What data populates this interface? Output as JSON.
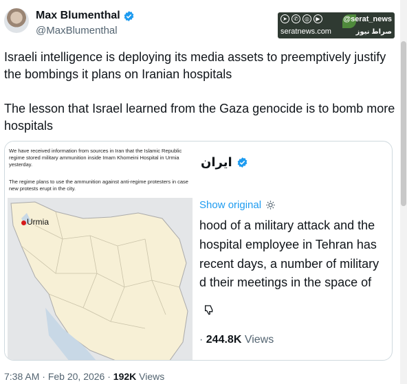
{
  "author": {
    "display_name": "Max Blumenthal",
    "handle": "@MaxBlumenthal",
    "verified_color": "#1d9bf0"
  },
  "watermark": {
    "handle": "@serat_news",
    "site": "seratnews.com",
    "arabic_name": "صراط نیوز",
    "icons": [
      "telegram-icon",
      "whatsapp-icon",
      "instagram-icon",
      "aparat-icon"
    ]
  },
  "tweet": {
    "paragraphs": [
      "Israeli intelligence is deploying its media assets to preemptively justify the bombings it plans on Iranian hospitals",
      "The lesson that Israel learned from the Gaza genocide is to bomb more hospitals"
    ]
  },
  "embedded_image": {
    "caption_1": "We have received information from sources in Iran that the Islamic Republic regime stored military ammunition inside Imam Khomeini Hospital in Urmia yesterday.",
    "caption_2": "The regime plans to use the ammunition  against anti-regime protesters in case new protests erupt in the city.",
    "map_label": "Urmia",
    "quoted_account": "ایران",
    "show_original": "Show original",
    "body_lines": [
      "hood of a military attack and the",
      "hospital employee in Tehran has",
      "recent days, a number of military",
      "d their meetings in the space of"
    ],
    "views_count": "244.8K",
    "views_label": "Views"
  },
  "meta": {
    "time": "7:38 AM",
    "date": "Feb 20, 2026",
    "views_count": "192K",
    "views_label": "Views",
    "separator": "·"
  }
}
